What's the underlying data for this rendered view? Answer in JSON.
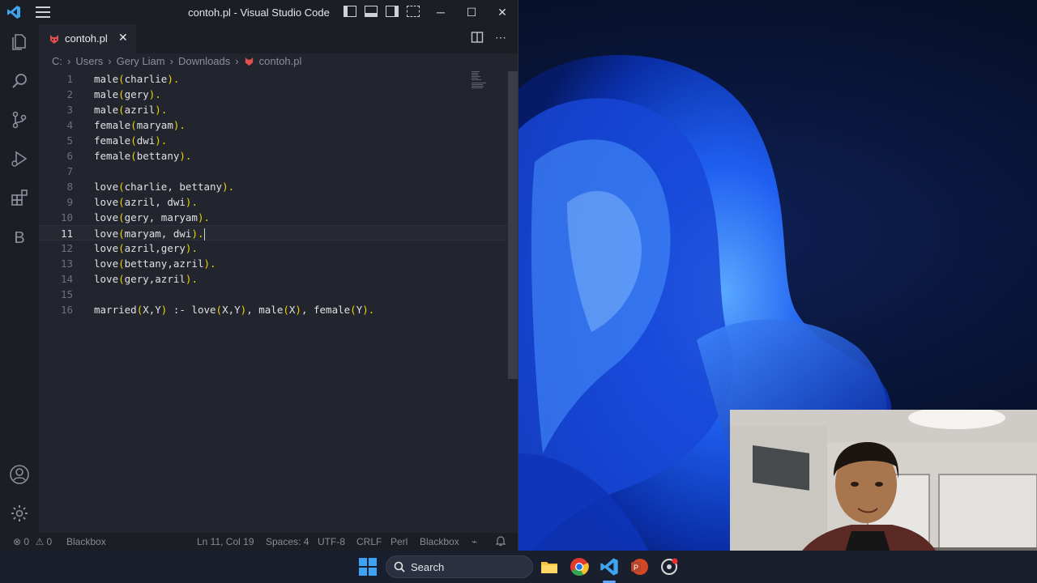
{
  "window": {
    "title": "contoh.pl - Visual Studio Code",
    "controls": {
      "minimize": "─",
      "maximize": "☐",
      "close": "✕"
    }
  },
  "activity_bar": {
    "items": [
      "explorer-icon",
      "search-icon",
      "source-control-icon",
      "run-debug-icon",
      "extensions-icon",
      "blackbox-icon"
    ],
    "blackbox_letter": "B",
    "bottom": [
      "accounts-icon",
      "manage-gear-icon"
    ]
  },
  "tab": {
    "label": "contoh.pl",
    "close": "✕"
  },
  "tab_actions": {
    "split": "split-editor-icon",
    "more": "⋯"
  },
  "breadcrumb": [
    "C:",
    "Users",
    "Gery Liam",
    "Downloads",
    "contoh.pl"
  ],
  "editor": {
    "active_line": 11,
    "lines": [
      {
        "n": "1",
        "text": "male(charlie)."
      },
      {
        "n": "2",
        "text": "male(gery)."
      },
      {
        "n": "3",
        "text": "male(azril)."
      },
      {
        "n": "4",
        "text": "female(maryam)."
      },
      {
        "n": "5",
        "text": "female(dwi)."
      },
      {
        "n": "6",
        "text": "female(bettany)."
      },
      {
        "n": "7",
        "text": ""
      },
      {
        "n": "8",
        "text": "love(charlie, bettany)."
      },
      {
        "n": "9",
        "text": "love(azril, dwi)."
      },
      {
        "n": "10",
        "text": "love(gery, maryam)."
      },
      {
        "n": "11",
        "text": "love(maryam, dwi)."
      },
      {
        "n": "12",
        "text": "love(azril,gery)."
      },
      {
        "n": "13",
        "text": "love(bettany,azril)."
      },
      {
        "n": "14",
        "text": "love(gery,azril)."
      },
      {
        "n": "15",
        "text": ""
      },
      {
        "n": "16",
        "text": "married(X,Y) :- love(X,Y), male(X), female(Y)."
      }
    ]
  },
  "status_bar": {
    "errors": "0",
    "warnings": "0",
    "blackbox_left": "Blackbox",
    "position": "Ln 11, Col 19",
    "spaces": "Spaces: 4",
    "encoding": "UTF-8",
    "eol": "CRLF",
    "language": "Perl",
    "blackbox_right": "Blackbox"
  },
  "taskbar": {
    "search_label": "Search",
    "apps": [
      "windows-start-icon",
      "copilot-icon",
      "file-explorer-icon",
      "chrome-icon",
      "vscode-icon",
      "powerpoint-icon",
      "app-icon"
    ]
  },
  "colors": {
    "punct": "#f1d700",
    "accent": "#0a84ff"
  }
}
